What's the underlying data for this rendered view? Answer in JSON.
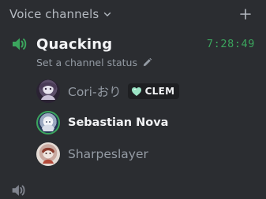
{
  "section": {
    "title": "Voice channels"
  },
  "channel": {
    "name": "Quacking",
    "timer": "7:28:49",
    "status_placeholder": "Set a channel status"
  },
  "users": [
    {
      "name": "Cori-おり",
      "active": false,
      "tag": "CLEM"
    },
    {
      "name": "Sebastian Nova",
      "active": true
    },
    {
      "name": "Sharpeslayer",
      "active": false
    }
  ],
  "colors": {
    "background": "#2b2d31",
    "speaking_green": "#3ba55d",
    "muted_text": "#949ba4",
    "bright_text": "#f2f3f5",
    "tag_heart": "#9be4c5"
  }
}
